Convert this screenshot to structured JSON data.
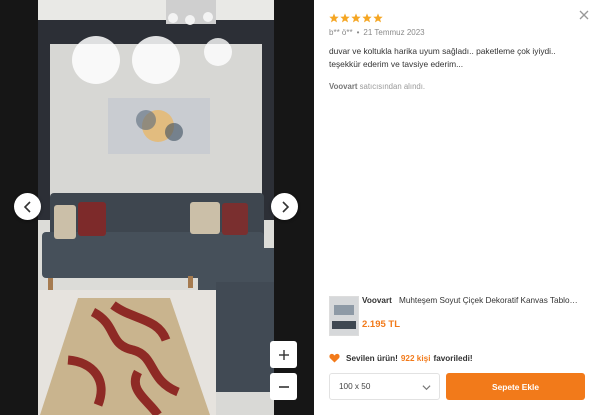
{
  "review": {
    "rating": 5,
    "author": "b** ö**",
    "date": "21 Temmuz 2023",
    "separator": "•",
    "text": "duvar ve koltukla harika uyum sağladı.. paketleme çok iyiydi.. teşekkür ederim ve tavsiye ederim...",
    "seller_name": "Voovart",
    "seller_suffix": "satıcısından alındı."
  },
  "product": {
    "brand": "Voovart",
    "name": "Muhteşem Soyut Çiçek Dekoratif Kanvas Tablo…",
    "price": "2.195 TL"
  },
  "favorites": {
    "prefix": "Sevilen ürün!",
    "count": "922 kişi",
    "suffix": "favoriledi!"
  },
  "size_select": {
    "selected": "100 x 50"
  },
  "add_to_cart_label": "Sepete Ekle",
  "colors": {
    "accent": "#f27a1a",
    "star": "#f5a623"
  },
  "icons": {
    "prev": "chevron-left-icon",
    "next": "chevron-right-icon",
    "zoom_in": "plus-icon",
    "zoom_out": "minus-icon",
    "close": "close-icon",
    "favorite": "heart-icon",
    "select": "chevron-down-icon"
  }
}
